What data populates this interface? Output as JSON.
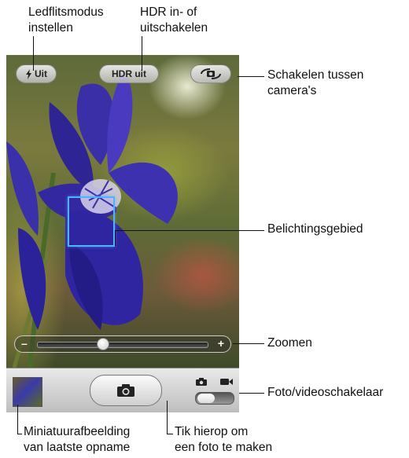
{
  "callouts": {
    "flash": [
      "Ledflitsmodus",
      "instellen"
    ],
    "hdr": [
      "HDR in- of",
      "uitschakelen"
    ],
    "switch_camera": [
      "Schakelen tussen",
      "camera's"
    ],
    "exposure": "Belichtingsgebied",
    "zoom": "Zoomen",
    "photo_video": "Foto/videoschakelaar",
    "thumbnail": [
      "Miniatuurafbeelding",
      "van laatste opname"
    ],
    "shutter": [
      "Tik hierop om",
      "een foto te maken"
    ]
  },
  "camera": {
    "flash_label": "Uit",
    "hdr_label": "HDR uit",
    "zoom_minus": "–",
    "zoom_plus": "+",
    "zoom_level": 0.39,
    "mode": "photo"
  },
  "icons": {
    "flash": "lightning-icon",
    "switch_camera": "camera-rotate-icon",
    "shutter": "camera-icon",
    "photo_mode": "camera-icon",
    "video_mode": "video-camera-icon"
  },
  "colors": {
    "focus_box": "#4fb2ff",
    "toolbar": "#d4d4d4"
  }
}
